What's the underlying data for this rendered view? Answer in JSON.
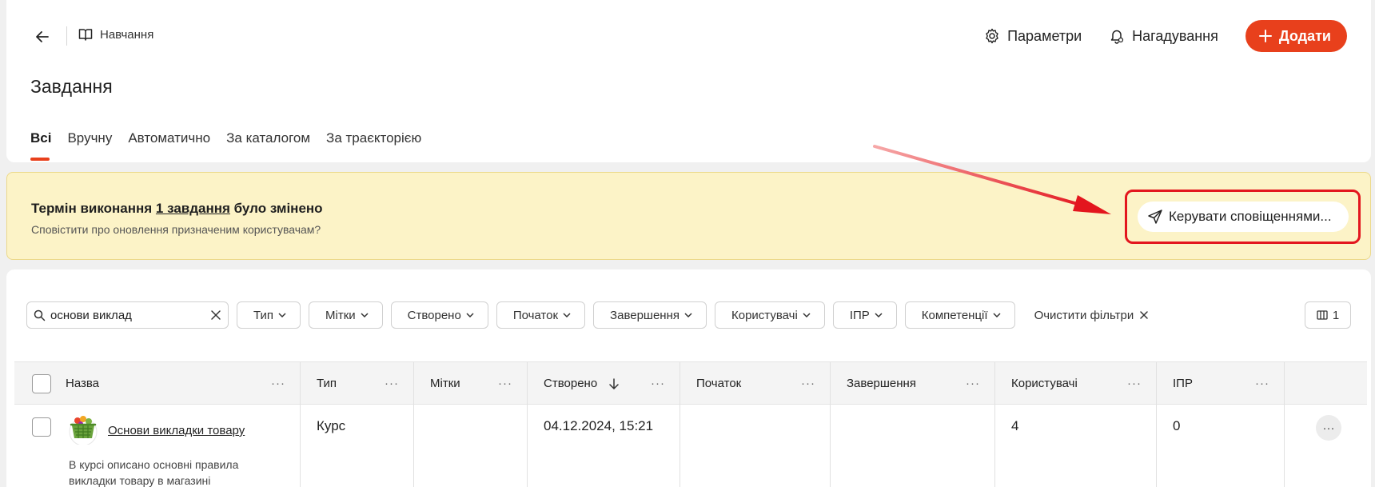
{
  "header": {
    "breadcrumb": "Навчання",
    "settings_label": "Параметри",
    "reminders_label": "Нагадування",
    "add_label": "Додати"
  },
  "page_title": "Завдання",
  "tabs": [
    {
      "label": "Всі",
      "active": true
    },
    {
      "label": "Вручну"
    },
    {
      "label": "Автоматично"
    },
    {
      "label": "За каталогом"
    },
    {
      "label": "За траєкторією"
    }
  ],
  "banner": {
    "title_prefix": "Термін виконання ",
    "title_link": "1 завдання",
    "title_suffix": " було змінено",
    "subtitle": "Сповістити про оновлення призначеним користувачам?",
    "button_label": "Керувати сповіщеннями..."
  },
  "filters": {
    "search_value": "основи виклад",
    "items": [
      "Тип",
      "Мітки",
      "Створено",
      "Початок",
      "Завершення",
      "Користувачі",
      "ІПР",
      "Компетенції"
    ],
    "clear_label": "Очистити фільтри",
    "columns_count": "1"
  },
  "table": {
    "columns": [
      "Назва",
      "Тип",
      "Мітки",
      "Створено",
      "Початок",
      "Завершення",
      "Користувачі",
      "ІПР"
    ],
    "rows": [
      {
        "name": "Основи викладки товару",
        "description": "В курсі описано основні правила викладки товару в магазині",
        "type": "Курс",
        "tags": "",
        "created": "04.12.2024, 15:21",
        "start": "",
        "end": "",
        "users": "4",
        "ipr": "0"
      }
    ]
  },
  "colors": {
    "accent": "#e8401c",
    "banner_bg": "#fcf3c7",
    "highlight": "#e3161e"
  }
}
